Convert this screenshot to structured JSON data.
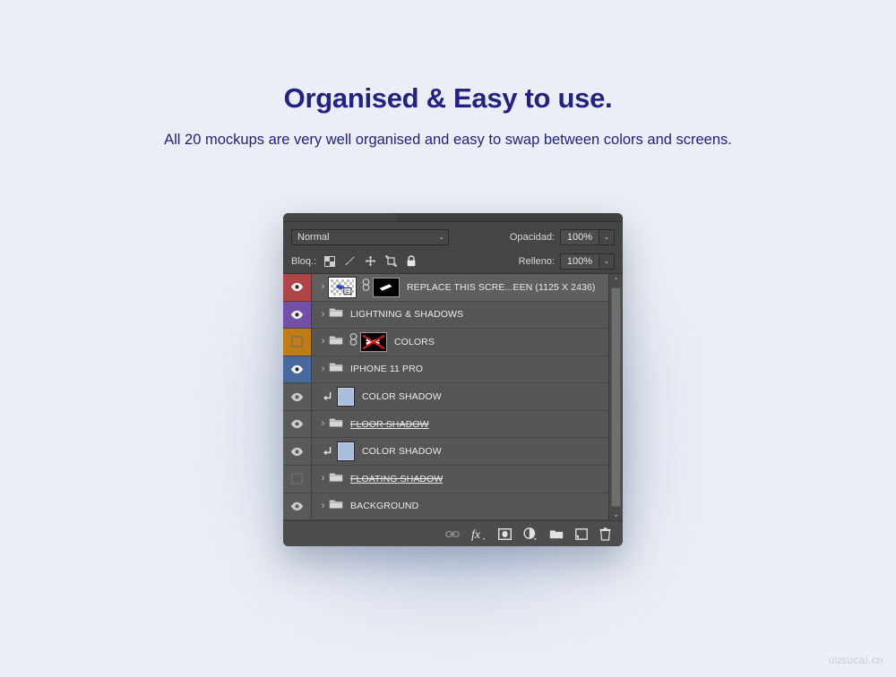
{
  "hero": {
    "title": "Organised & Easy to use.",
    "subtitle": "All 20 mockups are very well organised and easy to swap between colors and screens.",
    "title_color": "#232185"
  },
  "panel": {
    "blend_mode": "Normal",
    "blend_caret": "⌄",
    "opacity_label": "Opacidad:",
    "opacity_value": "100%",
    "fill_label": "Relleno:",
    "fill_value": "100%",
    "lock_label": "Bloq.:",
    "lock_icons": [
      "transparency-lock-icon",
      "brush-lock-icon",
      "move-lock-icon",
      "artboard-lock-icon",
      "lock-all-icon"
    ],
    "scrollbar": {
      "up": "⌃",
      "down": "⌄"
    },
    "layers": [
      {
        "name": "REPLACE THIS SCRE...EEN (1125 X 2436)",
        "visible": true,
        "color": "red",
        "kind": "smart-object",
        "has_link": true,
        "has_mask": true,
        "selected": true,
        "struck": false
      },
      {
        "name": "LIGHTNING & SHADOWS",
        "visible": true,
        "color": "purple",
        "kind": "group",
        "has_link": false,
        "has_mask": false,
        "selected": false,
        "struck": false
      },
      {
        "name": "COLORS",
        "visible": false,
        "color": "orange",
        "kind": "group",
        "has_link": true,
        "has_mask": true,
        "mask_disabled": true,
        "selected": false,
        "struck": false
      },
      {
        "name": "IPHONE 11 PRO",
        "visible": true,
        "color": "blue",
        "kind": "group",
        "has_link": false,
        "has_mask": false,
        "selected": false,
        "struck": false
      },
      {
        "name": "COLOR SHADOW",
        "visible": true,
        "color": "none",
        "kind": "clipped-layer",
        "has_link": false,
        "has_mask": false,
        "selected": false,
        "struck": false
      },
      {
        "name": "FLOOR SHADOW",
        "visible": true,
        "color": "none",
        "kind": "group",
        "has_link": false,
        "has_mask": false,
        "selected": false,
        "struck": true
      },
      {
        "name": "COLOR SHADOW",
        "visible": true,
        "color": "none",
        "kind": "clipped-layer",
        "has_link": false,
        "has_mask": false,
        "selected": false,
        "struck": false
      },
      {
        "name": "FLOATING SHADOW",
        "visible": false,
        "color": "none",
        "kind": "group",
        "has_link": false,
        "has_mask": false,
        "selected": false,
        "struck": true
      },
      {
        "name": "BACKGROUND",
        "visible": true,
        "color": "none",
        "kind": "group",
        "has_link": false,
        "has_mask": false,
        "selected": false,
        "struck": false
      }
    ],
    "footer_icons": [
      "link-layers-icon",
      "layer-styles-fx-icon",
      "add-layer-mask-icon",
      "new-adjustment-layer-icon",
      "new-group-icon",
      "new-layer-icon",
      "delete-layer-icon"
    ]
  },
  "watermark": "uusucai.cn"
}
